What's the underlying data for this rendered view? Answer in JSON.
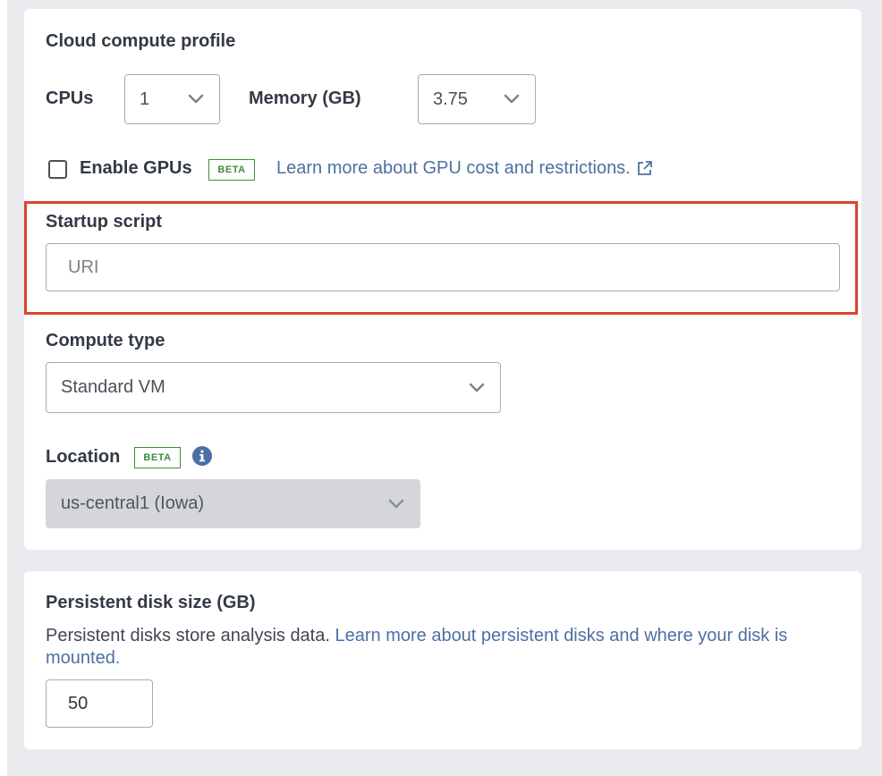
{
  "cloud_compute": {
    "title": "Cloud compute profile",
    "cpus_label": "CPUs",
    "cpus_value": "1",
    "memory_label": "Memory (GB)",
    "memory_value": "3.75",
    "enable_gpus_label": "Enable GPUs",
    "enable_gpus_checked": false,
    "beta_badge": "BETA",
    "gpu_learn_more": "Learn more about GPU cost and restrictions.",
    "startup_script_label": "Startup script",
    "startup_script_placeholder": "URI",
    "startup_script_value": "",
    "compute_type_label": "Compute type",
    "compute_type_value": "Standard VM",
    "location_label": "Location",
    "location_value": "us-central1 (Iowa)"
  },
  "persistent_disk": {
    "title": "Persistent disk size (GB)",
    "description": "Persistent disks store analysis data.",
    "learn_more": "Learn more about persistent disks and where your disk is mounted.",
    "value": "50"
  },
  "colors": {
    "highlight": "#d9432c",
    "link": "#4d6fa3",
    "beta": "#3f8b3c",
    "info_icon": "#4d6fa3"
  },
  "icons": {
    "chevron": "chevron-down-icon",
    "external_link": "external-link-icon",
    "info": "info-icon"
  }
}
